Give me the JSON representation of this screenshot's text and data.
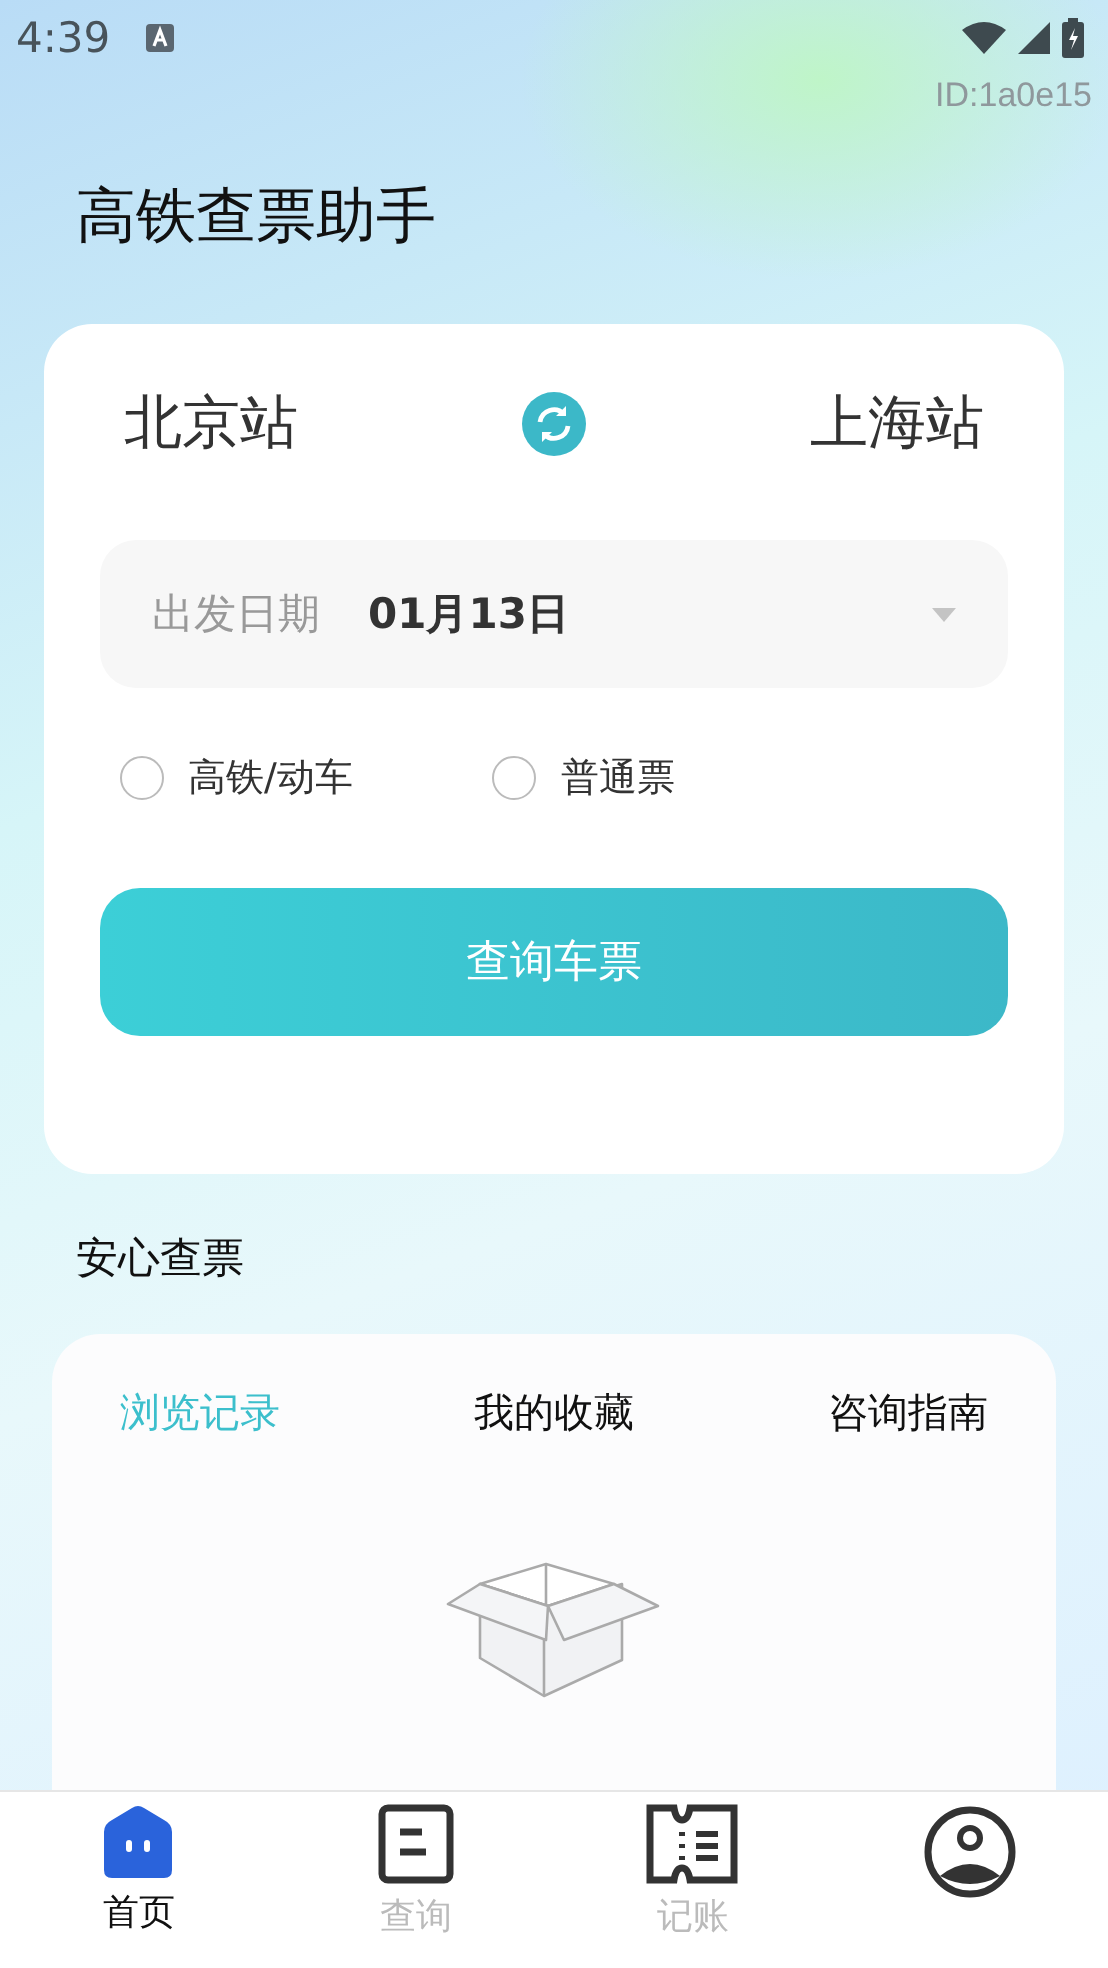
{
  "status_bar": {
    "time": "4:39"
  },
  "id_label": "ID:1a0e15",
  "title": "高铁查票助手",
  "search": {
    "from": "北京站",
    "to": "上海站",
    "date_label": "出发日期",
    "date": "01月13日",
    "train_types": [
      {
        "label": "高铁/动车",
        "selected": false
      },
      {
        "label": "普通票",
        "selected": false
      }
    ],
    "button": "查询车票"
  },
  "section_title": "安心查票",
  "tabs": [
    {
      "label": "浏览记录",
      "selected": true
    },
    {
      "label": "我的收藏",
      "selected": false
    },
    {
      "label": "咨询指南",
      "selected": false
    }
  ],
  "nav": [
    {
      "kind": "home",
      "label": "首页",
      "selected": true
    },
    {
      "kind": "query",
      "label": "查询",
      "selected": false
    },
    {
      "kind": "ledger",
      "label": "记账",
      "selected": false
    },
    {
      "kind": "profile",
      "selected": false
    }
  ]
}
